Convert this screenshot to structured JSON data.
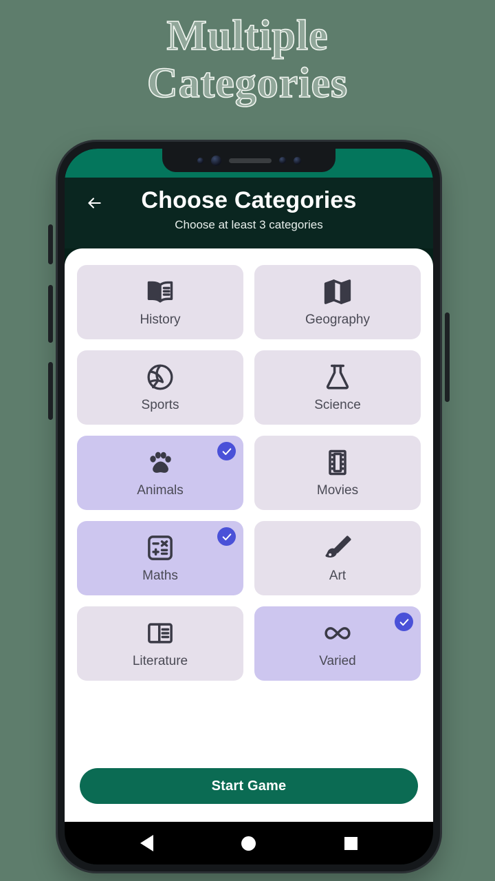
{
  "headline": {
    "line1": "Multiple",
    "line2": "Categories"
  },
  "colors": {
    "page_background": "#5E7D6C",
    "status_bar": "#04765C",
    "app_bar": "#0A2620",
    "sheet": "#FFFFFF",
    "card_unselected": "#E6E0EB",
    "card_selected": "#CDC6EF",
    "check_badge": "#4A51D8",
    "start_button": "#0B6B53",
    "icon": "#3A3A46",
    "label": "#4A4A55"
  },
  "appbar": {
    "back_icon": "arrow-left-icon",
    "title": "Choose Categories",
    "subtitle": "Choose at least 3 categories"
  },
  "categories": [
    {
      "label": "History",
      "icon": "open-book-icon",
      "selected": false
    },
    {
      "label": "Geography",
      "icon": "folded-map-icon",
      "selected": false
    },
    {
      "label": "Sports",
      "icon": "volleyball-icon",
      "selected": false
    },
    {
      "label": "Science",
      "icon": "flask-icon",
      "selected": false
    },
    {
      "label": "Animals",
      "icon": "paw-print-icon",
      "selected": true
    },
    {
      "label": "Movies",
      "icon": "film-strip-icon",
      "selected": false
    },
    {
      "label": "Maths",
      "icon": "calculator-icon",
      "selected": true
    },
    {
      "label": "Art",
      "icon": "paint-brush-icon",
      "selected": false
    },
    {
      "label": "Literature",
      "icon": "article-icon",
      "selected": false
    },
    {
      "label": "Varied",
      "icon": "infinity-icon",
      "selected": true
    }
  ],
  "actions": {
    "start_label": "Start Game"
  },
  "navbar": {
    "back": "nav-back-icon",
    "home": "nav-home-icon",
    "recents": "nav-recents-icon"
  }
}
